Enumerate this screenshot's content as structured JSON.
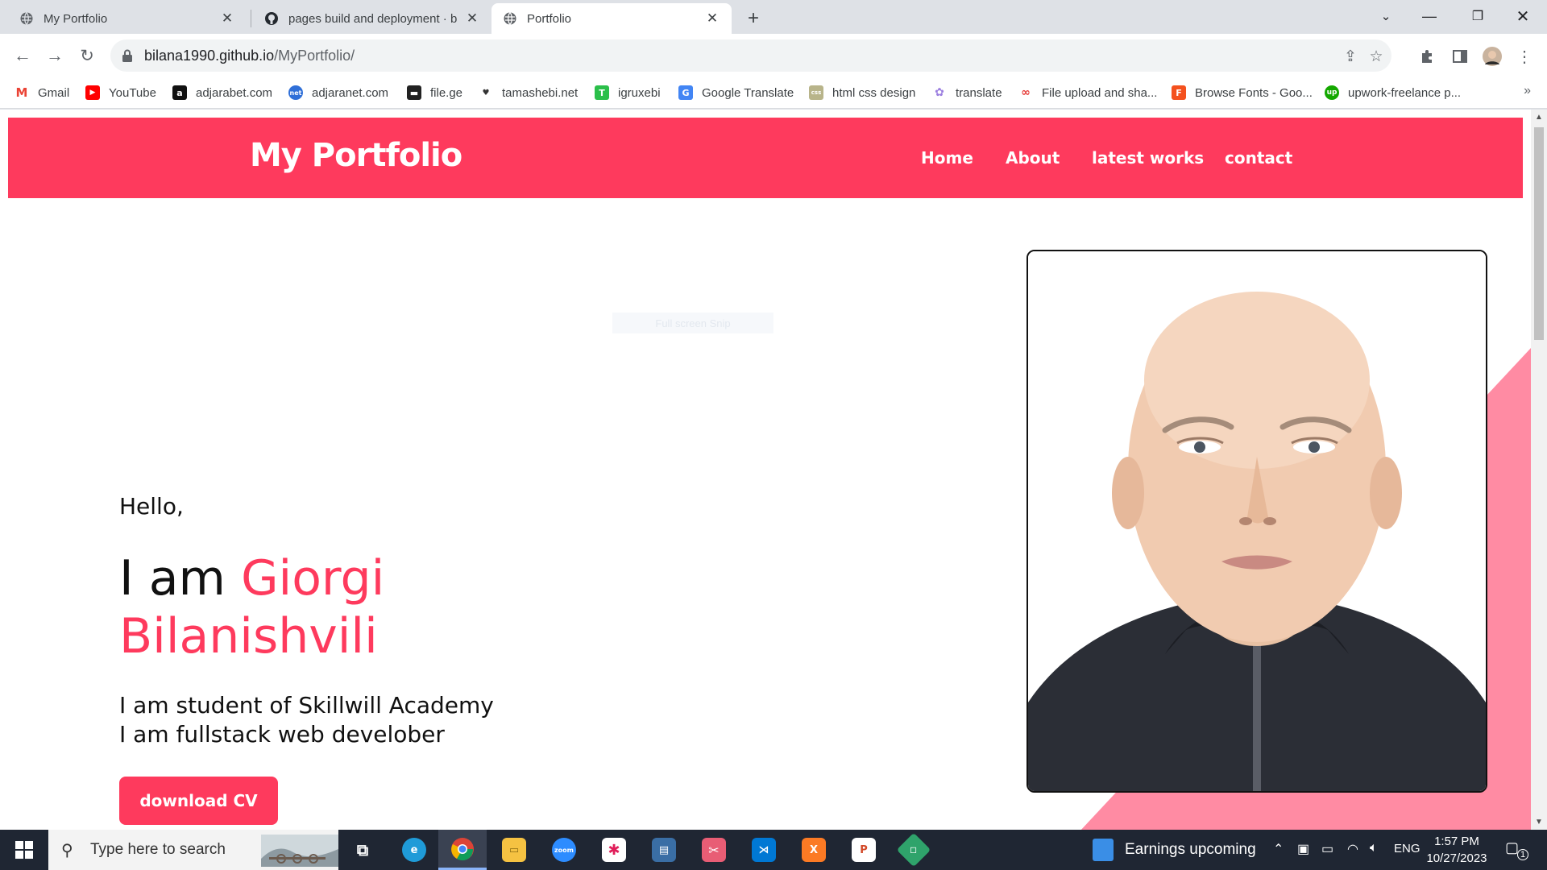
{
  "browser": {
    "tabs": [
      {
        "title": "My Portfolio",
        "active": false
      },
      {
        "title": "pages build and deployment · b",
        "active": false
      },
      {
        "title": "Portfolio",
        "active": true
      }
    ],
    "url_host": "bilana1990.github.io",
    "url_path": "/MyPortfolio/",
    "bookmarks": [
      {
        "label": "Gmail",
        "icon": "gmail-icon",
        "color": "#ea4335"
      },
      {
        "label": "YouTube",
        "icon": "youtube-icon",
        "color": "#ff0000"
      },
      {
        "label": "adjarabet.com",
        "icon": "adjarabet-icon",
        "color": "#111111"
      },
      {
        "label": "adjaranet.com",
        "icon": "adjaranet-icon",
        "color": "#2f6fd8"
      },
      {
        "label": "file.ge",
        "icon": "file-ge-icon",
        "color": "#222222"
      },
      {
        "label": "tamashebi.net",
        "icon": "tamashebi-icon",
        "color": "#333333"
      },
      {
        "label": "igruxebi",
        "icon": "igruxebi-icon",
        "color": "#2bbf4a"
      },
      {
        "label": "Google Translate",
        "icon": "google-translate-icon",
        "color": "#4285f4"
      },
      {
        "label": "html css design",
        "icon": "css-icon",
        "color": "#b8b48a"
      },
      {
        "label": "translate",
        "icon": "translate-icon",
        "color": "#9c7fe0"
      },
      {
        "label": "File upload and sha...",
        "icon": "file-upload-icon",
        "color": "#e53935"
      },
      {
        "label": "Browse Fonts - Goo...",
        "icon": "google-fonts-icon",
        "color": "#f4511e"
      },
      {
        "label": "upwork-freelance p...",
        "icon": "upwork-icon",
        "color": "#14a800"
      }
    ]
  },
  "site": {
    "logo": "My Portfolio",
    "nav": [
      "Home",
      "About",
      "latest works",
      "contact"
    ],
    "hidden_tip": "Full screen Snip",
    "hello": "Hello,",
    "iam_prefix": "I am ",
    "name_first": "Giorgi",
    "name_last": "Bilanishvili",
    "sub_line_1": "I am student of Skillwill Academy",
    "sub_line_2": "I am fullstack web develober",
    "cv_button": "download CV",
    "accent_color": "#fe3a5d",
    "accent_light": "#ff8ba3"
  },
  "taskbar": {
    "search_placeholder": "Type here to search",
    "news": "Earnings upcoming",
    "language": "ENG",
    "time": "1:57 PM",
    "date": "10/27/2023",
    "notification_count": "1"
  }
}
